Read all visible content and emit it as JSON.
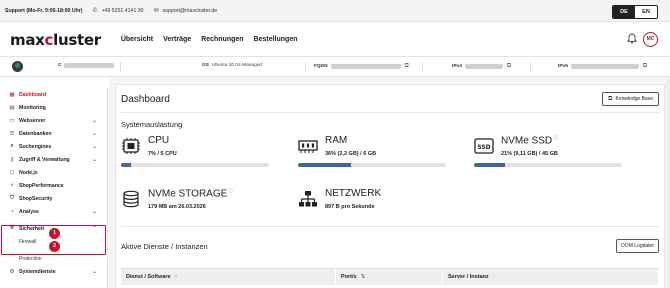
{
  "topbar": {
    "support": "Support (Mo-Fr, 9:00-18:00 Uhr)",
    "phone_icon": "phone-icon",
    "phone": "+49 5251 4141 30",
    "mail_icon": "mail-icon",
    "email": "support@maxcluster.de",
    "lang_de": "DE",
    "lang_en": "EN"
  },
  "nav": {
    "logo_prefix": "max",
    "logo_accent": "c",
    "logo_suffix": "luster",
    "links": [
      "Übersicht",
      "Verträge",
      "Rechnungen",
      "Bestellungen"
    ],
    "user_initials": "MC"
  },
  "infobar": {
    "label_c": "C",
    "os_label": "OS",
    "os_value": "Ubuntu 20.04 Managed",
    "fqdn_label": "FQDN",
    "ipv4_label": "IPv4",
    "ipv6_label": "IPv6"
  },
  "sidebar": {
    "items": [
      {
        "label": "Dashboard",
        "icon": "dashboard-icon",
        "active": true
      },
      {
        "label": "Monitoring",
        "icon": "monitoring-icon"
      },
      {
        "label": "Webserver",
        "icon": "webserver-icon",
        "chevron": true
      },
      {
        "label": "Datenbanken",
        "icon": "database-icon",
        "chevron": true
      },
      {
        "label": "Suchengines",
        "icon": "search-icon",
        "chevron": true
      },
      {
        "label": "Zugriff & Verwaltung",
        "icon": "key-icon",
        "chevron": true
      },
      {
        "label": "Node.js",
        "icon": "nodejs-icon"
      },
      {
        "label": "ShopPerformance",
        "icon": "performance-icon"
      },
      {
        "label": "ShopSecurity",
        "icon": "shield-icon"
      },
      {
        "label": "Analyse",
        "icon": "analysis-icon",
        "chevron": true
      },
      {
        "label": "Sicherheit",
        "icon": "security-icon",
        "chevron": true,
        "expanded": true
      }
    ],
    "sub_firewall": "Firewall",
    "sub_protection": "Protection",
    "systemdienste": "Systemdienste",
    "marker_1": "1",
    "marker_2": "2"
  },
  "main": {
    "title": "Dashboard",
    "knowledge_base": "Knowledge Base",
    "systemauslastung": "Systemauslastung",
    "resources": [
      {
        "name": "CPU",
        "value": "7% / 5 CPU",
        "usage": 0.07,
        "icon": "cpu-icon"
      },
      {
        "name": "RAM",
        "value": "36% (2,2 GB) / 6 GB",
        "usage": 0.36,
        "icon": "ram-icon"
      },
      {
        "name": "NVMe SSD",
        "value": "21% (9,11 GB) / 45 GB",
        "usage": 0.21,
        "icon": "ssd-icon"
      },
      {
        "name": "NVMe STORAGE",
        "value": "179 MB am 26.03.2026",
        "icon": "storage-icon"
      },
      {
        "name": "NETZWERK",
        "value": "897 B pro Sekunde",
        "icon": "network-icon"
      }
    ],
    "services_title": "Aktive Dienste / Instanzen",
    "oom_button": "OOM Logdater",
    "table_headers": [
      "Dienst / Software",
      "Port/s",
      "Server / Instanz"
    ]
  },
  "colors": {
    "brand": "#c8102e",
    "bar_fill": "#3f64a8"
  }
}
